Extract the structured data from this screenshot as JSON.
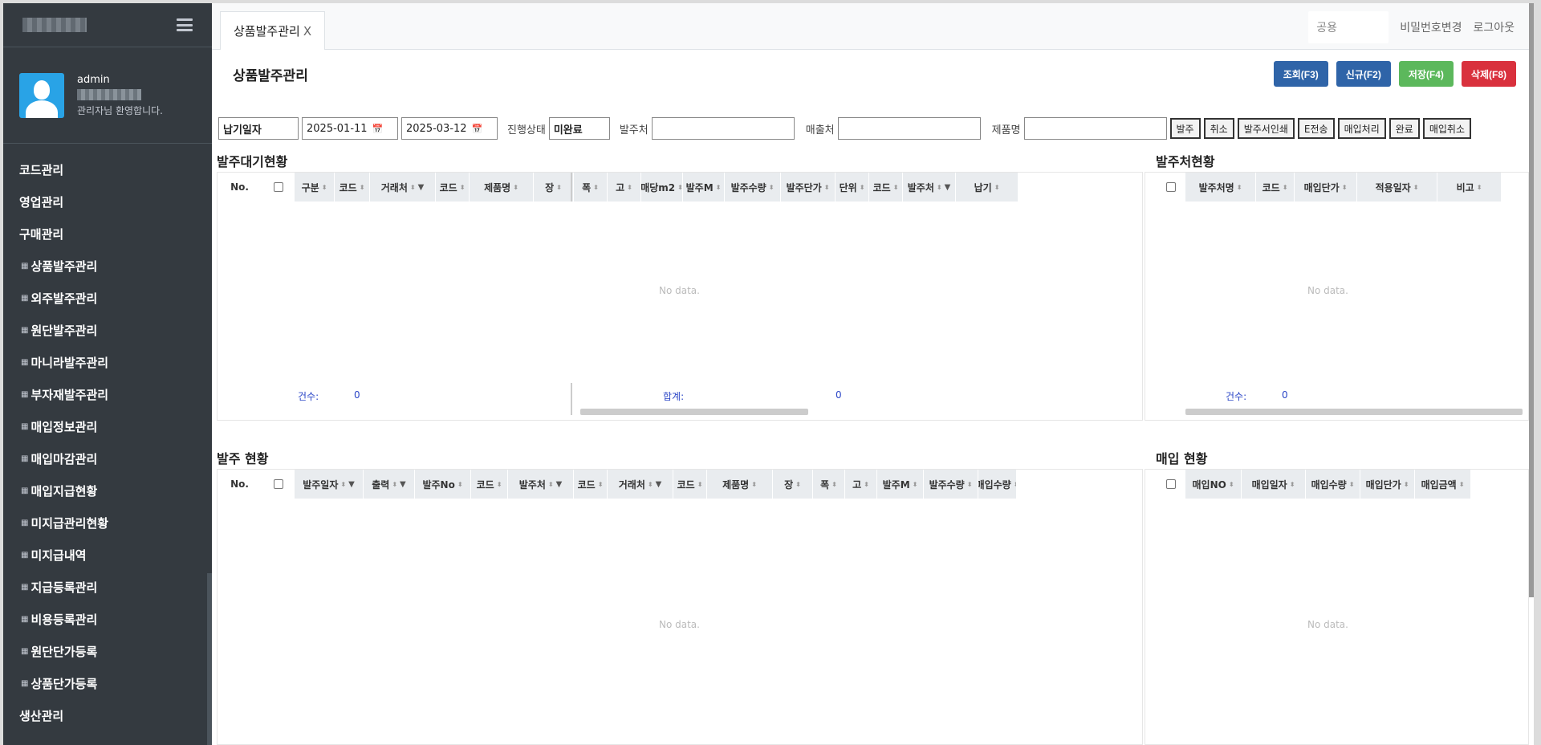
{
  "sidebar": {
    "user_name": "admin",
    "welcome": "관리자님 환영합니다.",
    "items": [
      {
        "label": "코드관리",
        "sub": false
      },
      {
        "label": "영업관리",
        "sub": false
      },
      {
        "label": "구매관리",
        "sub": false
      },
      {
        "label": "상품발주관리",
        "sub": true
      },
      {
        "label": "외주발주관리",
        "sub": true
      },
      {
        "label": "원단발주관리",
        "sub": true
      },
      {
        "label": "마니라발주관리",
        "sub": true
      },
      {
        "label": "부자재발주관리",
        "sub": true
      },
      {
        "label": "매입정보관리",
        "sub": true
      },
      {
        "label": "매입마감관리",
        "sub": true
      },
      {
        "label": "매입지급현황",
        "sub": true
      },
      {
        "label": "미지급관리현황",
        "sub": true
      },
      {
        "label": "미지급내역",
        "sub": true
      },
      {
        "label": "지급등록관리",
        "sub": true
      },
      {
        "label": "비용등록관리",
        "sub": true
      },
      {
        "label": "원단단가등록",
        "sub": true
      },
      {
        "label": "상품단가등록",
        "sub": true
      },
      {
        "label": "생산관리",
        "sub": false
      }
    ]
  },
  "header": {
    "tab_label": "상품발주관리",
    "tab_close": "X",
    "shared": "공용",
    "change_password": "비밀번호변경",
    "logout": "로그아웃"
  },
  "page": {
    "title": "상품발주관리",
    "actions": [
      {
        "label": "조회(F3)",
        "color": "#2f64a8",
        "name": "search-button"
      },
      {
        "label": "신규(F2)",
        "color": "#2f64a8",
        "name": "new-button"
      },
      {
        "label": "저장(F4)",
        "color": "#5cb85c",
        "name": "save-button"
      },
      {
        "label": "삭제(F8)",
        "color": "#d9313d",
        "name": "delete-button"
      }
    ]
  },
  "filter": {
    "date_type": "납기일자",
    "date_from": "2025-01-11",
    "date_to": "2025-03-12",
    "status_label": "진행상태",
    "status_value": "미완료",
    "supplier_label": "발주처",
    "customer_label": "매출처",
    "product_label": "제품명",
    "buttons": [
      "발주",
      "취소",
      "발주서인쇄",
      "E전송",
      "매입처리",
      "완료",
      "매입취소"
    ]
  },
  "sections": {
    "waiting": {
      "title": "발주대기현황",
      "columns": [
        "No.",
        "",
        "구분",
        "코드",
        "거래처",
        "코드",
        "제품명",
        "장",
        "폭",
        "고",
        "매당m2",
        "발주M",
        "발주수량",
        "발주단가",
        "단위",
        "코드",
        "발주처",
        "납기"
      ],
      "no_data": "No data.",
      "count_label": "건수:",
      "count_value": "0",
      "sum_label": "합계:",
      "sum_value": "0"
    },
    "supplier": {
      "title": "발주처현황",
      "columns": [
        "",
        "발주처명",
        "코드",
        "매입단가",
        "적용일자",
        "비고"
      ],
      "no_data": "No data.",
      "count_label": "건수:",
      "count_value": "0"
    },
    "orders": {
      "title": "발주 현황",
      "columns": [
        "No.",
        "",
        "발주일자",
        "출력",
        "발주No",
        "코드",
        "발주처",
        "코드",
        "거래처",
        "코드",
        "제품명",
        "장",
        "폭",
        "고",
        "발주M",
        "발주수량",
        "매입수량"
      ],
      "no_data": "No data."
    },
    "purchase": {
      "title": "매입 현황",
      "columns": [
        "",
        "매입NO",
        "매입일자",
        "매입수량",
        "매입단가",
        "매입금액"
      ],
      "no_data": "No data."
    }
  }
}
